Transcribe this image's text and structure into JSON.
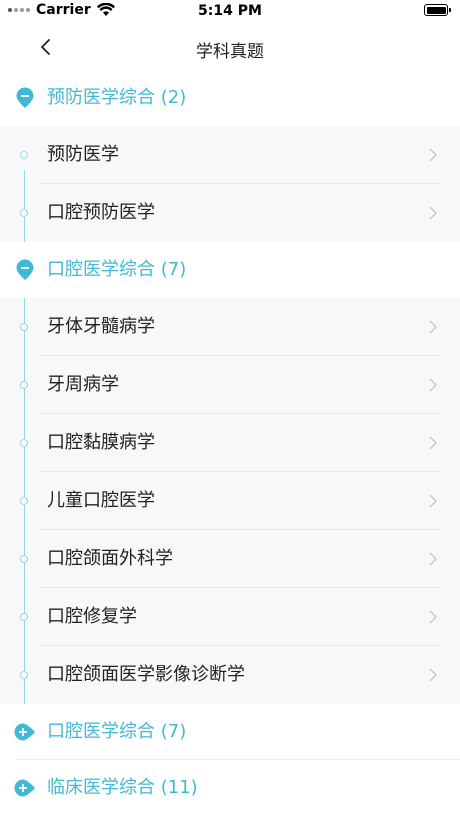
{
  "status_bar": {
    "carrier": "Carrier",
    "time": "5:14 PM"
  },
  "nav": {
    "title": "学科真题"
  },
  "groups": [
    {
      "title": "预防医学综合 (2)",
      "expanded": true,
      "items": [
        {
          "label": "预防医学"
        },
        {
          "label": "口腔预防医学"
        }
      ]
    },
    {
      "title": "口腔医学综合 (7)",
      "expanded": true,
      "items": [
        {
          "label": "牙体牙髓病学"
        },
        {
          "label": "牙周病学"
        },
        {
          "label": "口腔黏膜病学"
        },
        {
          "label": "儿童口腔医学"
        },
        {
          "label": "口腔颌面外科学"
        },
        {
          "label": "口腔修复学"
        },
        {
          "label": "口腔颌面医学影像诊断学"
        }
      ]
    },
    {
      "title": "口腔医学综合 (7)",
      "expanded": false,
      "items": []
    },
    {
      "title": "临床医学综合 (11)",
      "expanded": false,
      "items": []
    }
  ],
  "colors": {
    "accent": "#41b9d4",
    "line": "#8fd8e8",
    "item_bg": "#f7f8fa"
  }
}
